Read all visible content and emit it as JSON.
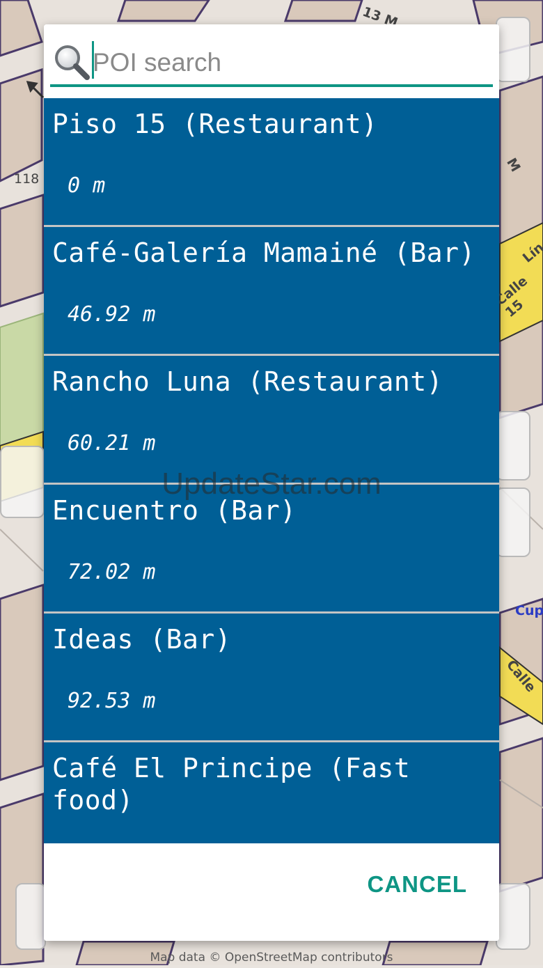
{
  "map": {
    "attribution": "Map data © OpenStreetMap contributors",
    "labels": [
      "118",
      "M",
      "Lín",
      "Calle 15",
      "Cup",
      "Calle",
      "13 M"
    ]
  },
  "search": {
    "placeholder": "POI search",
    "value": "",
    "icon": "search-icon",
    "accent_color": "#0e9584"
  },
  "poi_list": {
    "item_color": "#005f96",
    "items": [
      {
        "name": "Piso 15 (Restaurant)",
        "distance": "0 m"
      },
      {
        "name": "Café-Galería Mamainé (Bar)",
        "distance": "46.92 m"
      },
      {
        "name": "Rancho Luna (Restaurant)",
        "distance": "60.21 m"
      },
      {
        "name": "Encuentro (Bar)",
        "distance": "72.02 m"
      },
      {
        "name": "Ideas (Bar)",
        "distance": "92.53 m"
      },
      {
        "name": "Café El Principe (Fast food)",
        "distance": ""
      }
    ]
  },
  "dialog": {
    "cancel_label": "CANCEL"
  },
  "watermark": "UpdateStar.com"
}
